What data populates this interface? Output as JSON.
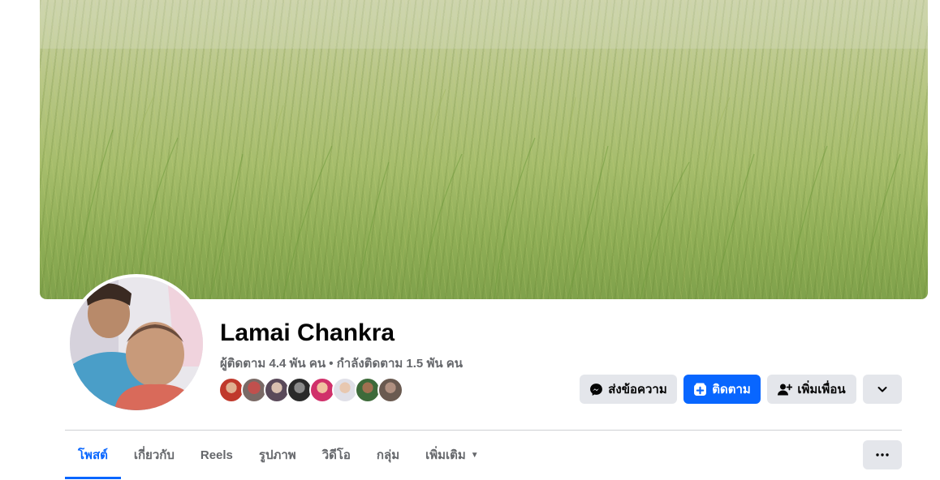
{
  "profile": {
    "name": "Lamai Chankra",
    "followers": "ผู้ติดตาม 4.4 พัน คน",
    "separator": " • ",
    "following": "กำลังติดตาม 1.5 พัน คน"
  },
  "actions": {
    "message": "ส่งข้อความ",
    "follow": "ติดตาม",
    "add_friend": "เพิ่มเพื่อน"
  },
  "tabs": [
    {
      "label": "โพสต์",
      "active": true
    },
    {
      "label": "เกี่ยวกับ"
    },
    {
      "label": "Reels"
    },
    {
      "label": "รูปภาพ"
    },
    {
      "label": "วิดีโอ"
    },
    {
      "label": "กลุ่ม"
    },
    {
      "label": "เพิ่มเติม"
    }
  ],
  "friend_avatar_count": 8,
  "colors": {
    "accent": "#0866ff",
    "button_gray": "#e4e6eb",
    "secondary_text": "#65676b",
    "divider": "#ced0d4"
  },
  "icons": [
    "messenger-icon",
    "follow-plus-icon",
    "add-friend-icon",
    "chevron-down-icon",
    "more-dots-icon"
  ]
}
